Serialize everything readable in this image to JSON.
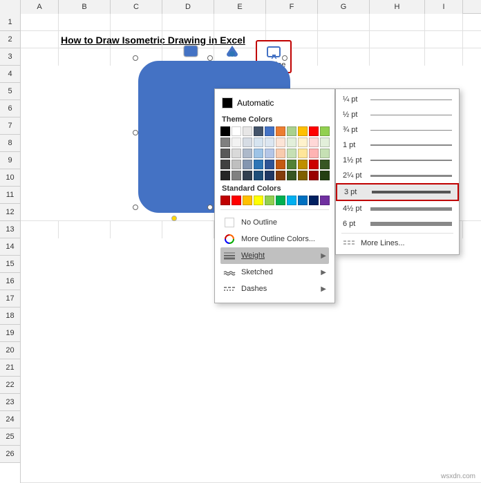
{
  "spreadsheet": {
    "title": "How to Draw Isometric Drawing in Excel",
    "columns": [
      "A",
      "B",
      "C",
      "D",
      "E",
      "F",
      "G",
      "H",
      "I"
    ],
    "rows": [
      "1",
      "2",
      "3",
      "4",
      "5",
      "6",
      "7",
      "8",
      "9",
      "10",
      "11",
      "12",
      "13",
      "14",
      "15",
      "16",
      "17",
      "18",
      "19",
      "20",
      "21",
      "22",
      "23",
      "24",
      "25",
      "26"
    ]
  },
  "toolbar": {
    "style_label": "Style",
    "fill_label": "Fill",
    "outline_label": "Outline"
  },
  "color_menu": {
    "automatic_label": "Automatic",
    "theme_colors_label": "Theme Colors",
    "standard_colors_label": "Standard Colors",
    "no_outline_label": "No Outline",
    "more_colors_label": "More Outline Colors...",
    "weight_label": "Weight",
    "sketched_label": "Sketched",
    "dashes_label": "Dashes",
    "theme_row1": [
      "#000000",
      "#ffffff",
      "#e7e6e6",
      "#44546a",
      "#4472c4",
      "#ed7d31",
      "#a9d18e",
      "#ffc000",
      "#ff0000",
      "#92d050"
    ],
    "theme_row2": [
      "#7f7f7f",
      "#f2f2f2",
      "#d6dce4",
      "#d6e4f0",
      "#dce6f1",
      "#fce4d6",
      "#e2efda",
      "#fff2cc",
      "#ffd7d7",
      "#e2efda"
    ],
    "theme_row3": [
      "#595959",
      "#d9d9d9",
      "#adb9ca",
      "#9dc3e6",
      "#b4c6e7",
      "#f8cbad",
      "#c6e0b4",
      "#ffe699",
      "#ffb3b3",
      "#c6e0b4"
    ],
    "theme_row4": [
      "#404040",
      "#bfbfbf",
      "#8496b0",
      "#2e75b6",
      "#2f5496",
      "#c55a11",
      "#538135",
      "#bf8f00",
      "#cc0000",
      "#375623"
    ],
    "theme_row5": [
      "#262626",
      "#808080",
      "#323f4f",
      "#1f4e79",
      "#1f3864",
      "#843c0c",
      "#375623",
      "#7f5f00",
      "#990000",
      "#243f13"
    ],
    "standard_colors": [
      "#ff0000",
      "#ff6600",
      "#ffff00",
      "#92d050",
      "#00b050",
      "#00b0f0",
      "#0070c0",
      "#002060",
      "#7030a0",
      "#ff0000"
    ],
    "weight_items": [
      {
        "label": "¼ pt",
        "height": 1
      },
      {
        "label": "½ pt",
        "height": 1
      },
      {
        "label": "¾ pt",
        "height": 1
      },
      {
        "label": "1 pt",
        "height": 2
      },
      {
        "label": "1½ pt",
        "height": 2
      },
      {
        "label": "2¼ pt",
        "height": 3
      },
      {
        "label": "3 pt",
        "height": 4
      },
      {
        "label": "4½ pt",
        "height": 5
      },
      {
        "label": "6 pt",
        "height": 6
      }
    ],
    "more_lines_label": "More Lines..."
  },
  "watermark": "wsxdn.com"
}
